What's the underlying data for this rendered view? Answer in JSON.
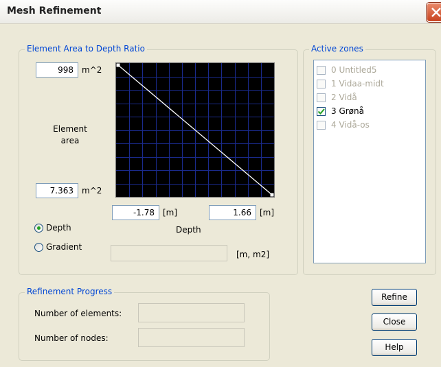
{
  "window": {
    "title": "Mesh Refinement"
  },
  "ratio_group": {
    "legend": "Element Area to Depth Ratio",
    "max_area_value": "998",
    "min_area_value": "7.363",
    "area_unit": "m^2",
    "element_area_label": "Element area",
    "depth_min_value": "-1.78",
    "depth_max_value": "1.66",
    "depth_unit": "[m]",
    "depth_axis_label": "Depth",
    "mode_options": [
      {
        "label": "Depth",
        "selected": true
      },
      {
        "label": "Gradient",
        "selected": false
      }
    ],
    "gradient_unit": "[m, m2]",
    "gradient_value": ""
  },
  "active_zones": {
    "legend": "Active zones",
    "items": [
      {
        "label": "0 Untitled5",
        "checked": false
      },
      {
        "label": "1 Vidaa-midt",
        "checked": false
      },
      {
        "label": "2 Vidå",
        "checked": false
      },
      {
        "label": "3 Grønå",
        "checked": true
      },
      {
        "label": "4 Vidå-os",
        "checked": false
      }
    ]
  },
  "progress": {
    "legend": "Refinement Progress",
    "elements_label": "Number of elements:",
    "nodes_label": "Number of nodes:",
    "elements_value": "",
    "nodes_value": ""
  },
  "buttons": {
    "refine": "Refine",
    "close": "Close",
    "help": "Help"
  },
  "colors": {
    "legend_blue": "#0046d5",
    "chart_bg": "#000000",
    "chart_grid": "#1a2a8c",
    "chart_line": "#ffffff"
  }
}
